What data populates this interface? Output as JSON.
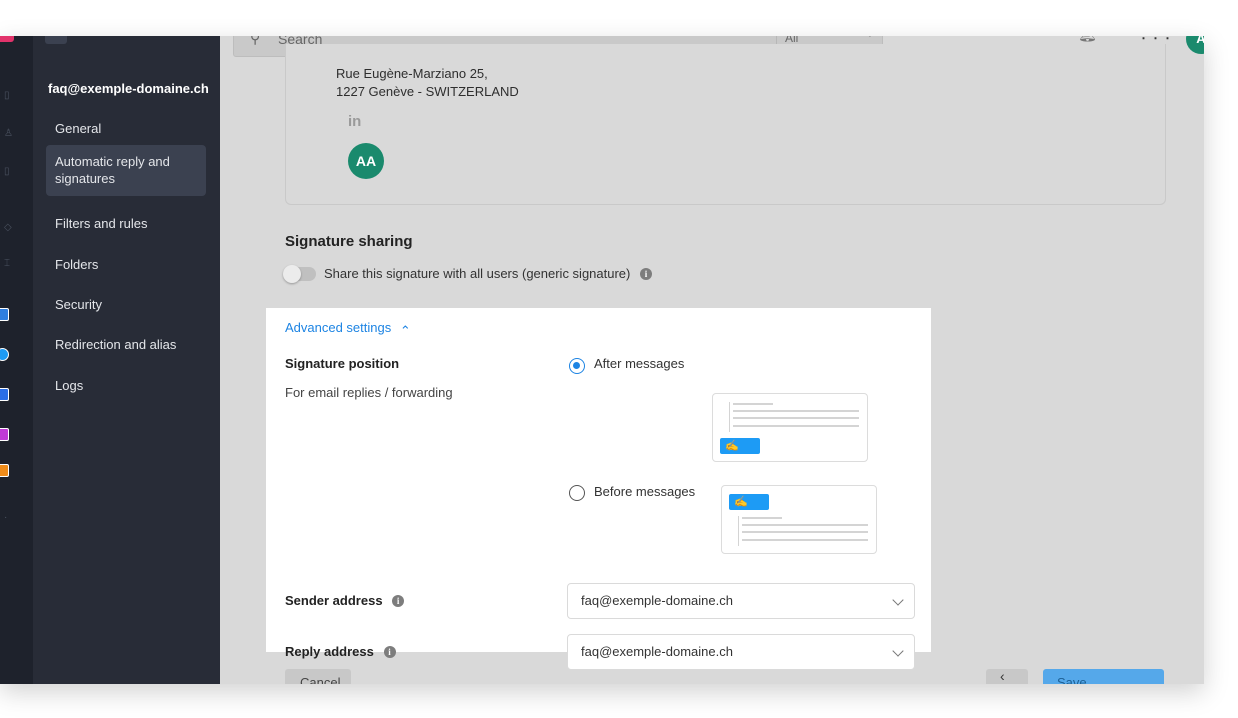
{
  "top": {
    "search_placeholder": "Search",
    "search_scope": "All",
    "user_initial": "A",
    "notif_count": "",
    "grid_glyph": "⋮⋮⋮"
  },
  "sidebar": {
    "account": "faq@exemple-domaine.ch",
    "items": [
      {
        "label": "General"
      },
      {
        "label": "Automatic reply and signatures"
      },
      {
        "label": "Filters and rules"
      },
      {
        "label": "Folders"
      },
      {
        "label": "Security"
      },
      {
        "label": "Redirection and alias"
      },
      {
        "label": "Logs"
      }
    ]
  },
  "signature_card": {
    "address_line1": "Rue Eugène-Marziano 25,",
    "address_line2": "1227 Genève - SWITZERLAND",
    "linkedin": "in",
    "avatar": "AA"
  },
  "sharing": {
    "title": "Signature sharing",
    "toggle_label": "Share this signature with all users (generic signature)",
    "toggle_on": false
  },
  "advanced": {
    "title": "Advanced settings",
    "chevron": "⌃",
    "position_label": "Signature position",
    "position_help": "For email replies / forwarding",
    "option_after": "After messages",
    "option_before": "Before messages",
    "selected": "after",
    "sender_label": "Sender address",
    "sender_value": "faq@exemple-domaine.ch",
    "reply_label": "Reply address",
    "reply_value": "faq@exemple-domaine.ch",
    "info_glyph": "i",
    "sig_glyph": "✍"
  },
  "footer": {
    "cancel_label": "Cancel",
    "back_label": "‹",
    "save_label": "Save"
  },
  "colors": {
    "accent": "#1d84e3",
    "sidebar_bg": "#282c37",
    "rail_bg": "#1e222c",
    "avatar_bg": "#1a8a6d"
  }
}
